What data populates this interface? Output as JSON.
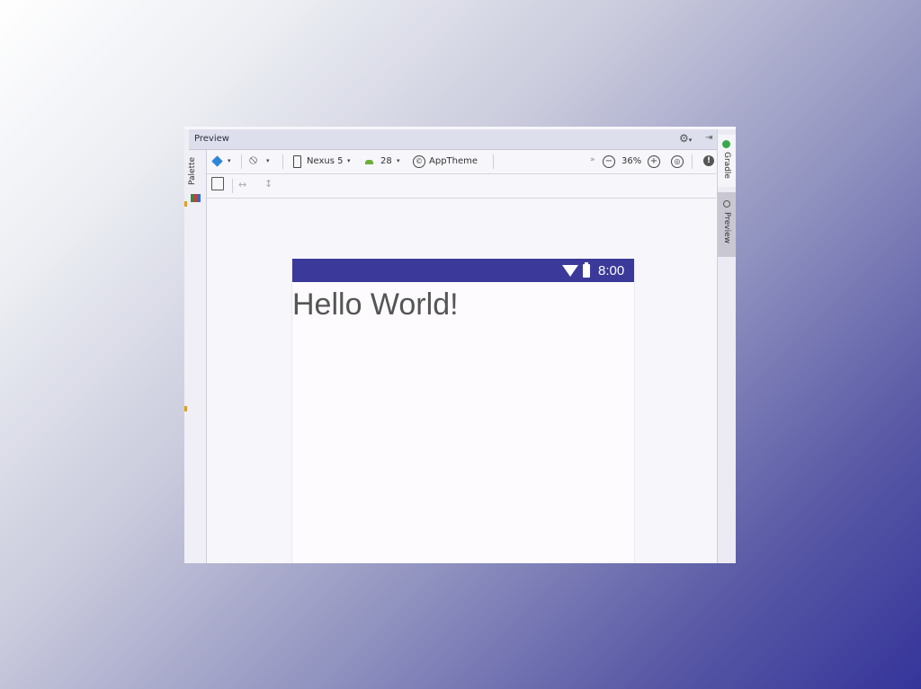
{
  "window": {
    "title": "Preview"
  },
  "left_panel": {
    "palette_label": "Palette"
  },
  "right_panel": {
    "gradle_label": "Gradle",
    "preview_label": "Preview"
  },
  "toolbar": {
    "device": "Nexus 5",
    "api_level": "28",
    "theme": "AppTheme",
    "zoom": "36%",
    "overflow": "»"
  },
  "device_preview": {
    "clock": "8:00",
    "text": "Hello World!",
    "statusbar_color": "#3b3a9a"
  }
}
